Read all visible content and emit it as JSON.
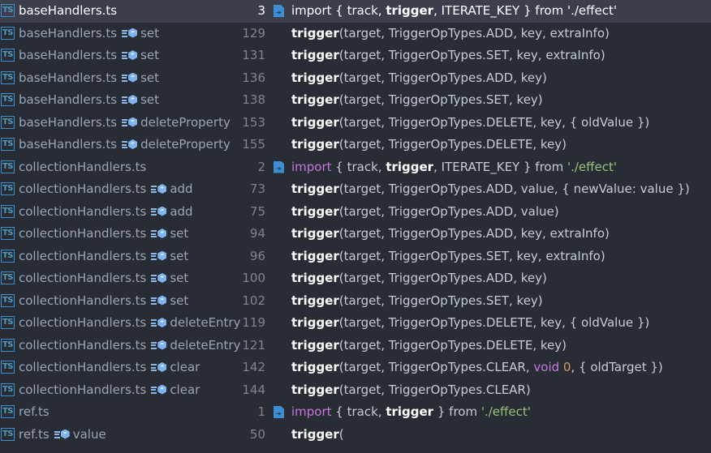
{
  "results": [
    {
      "file": "baseHandlers.ts",
      "symbol": "",
      "line": "3",
      "import": true,
      "selected": true,
      "code": [
        {
          "t": "import",
          "k": "kw"
        },
        {
          "t": " { track, "
        },
        {
          "t": "trigger",
          "k": "match"
        },
        {
          "t": ", ITERATE_KEY } from "
        },
        {
          "t": "'./effect'",
          "k": "str"
        }
      ]
    },
    {
      "file": "baseHandlers.ts",
      "symbol": "set",
      "line": "129",
      "code": [
        {
          "t": "trigger",
          "k": "match"
        },
        {
          "t": "(target, TriggerOpTypes.ADD, key, extraInfo)"
        }
      ]
    },
    {
      "file": "baseHandlers.ts",
      "symbol": "set",
      "line": "131",
      "code": [
        {
          "t": "trigger",
          "k": "match"
        },
        {
          "t": "(target, TriggerOpTypes.SET, key, extraInfo)"
        }
      ]
    },
    {
      "file": "baseHandlers.ts",
      "symbol": "set",
      "line": "136",
      "code": [
        {
          "t": "trigger",
          "k": "match"
        },
        {
          "t": "(target, TriggerOpTypes.ADD, key)"
        }
      ]
    },
    {
      "file": "baseHandlers.ts",
      "symbol": "set",
      "line": "138",
      "code": [
        {
          "t": "trigger",
          "k": "match"
        },
        {
          "t": "(target, TriggerOpTypes.SET, key)"
        }
      ]
    },
    {
      "file": "baseHandlers.ts",
      "symbol": "deleteProperty",
      "line": "153",
      "code": [
        {
          "t": "trigger",
          "k": "match"
        },
        {
          "t": "(target, TriggerOpTypes.DELETE, key, { oldValue })"
        }
      ]
    },
    {
      "file": "baseHandlers.ts",
      "symbol": "deleteProperty",
      "line": "155",
      "code": [
        {
          "t": "trigger",
          "k": "match"
        },
        {
          "t": "(target, TriggerOpTypes.DELETE, key)"
        }
      ]
    },
    {
      "file": "collectionHandlers.ts",
      "symbol": "",
      "line": "2",
      "import": true,
      "code": [
        {
          "t": "import",
          "k": "kw"
        },
        {
          "t": " { track, "
        },
        {
          "t": "trigger",
          "k": "match"
        },
        {
          "t": ", ITERATE_KEY } from "
        },
        {
          "t": "'./effect'",
          "k": "str"
        }
      ]
    },
    {
      "file": "collectionHandlers.ts",
      "symbol": "add",
      "line": "73",
      "code": [
        {
          "t": "trigger",
          "k": "match"
        },
        {
          "t": "(target, TriggerOpTypes.ADD, value, { newValue: value })"
        }
      ]
    },
    {
      "file": "collectionHandlers.ts",
      "symbol": "add",
      "line": "75",
      "code": [
        {
          "t": "trigger",
          "k": "match"
        },
        {
          "t": "(target, TriggerOpTypes.ADD, value)"
        }
      ]
    },
    {
      "file": "collectionHandlers.ts",
      "symbol": "set",
      "line": "94",
      "code": [
        {
          "t": "trigger",
          "k": "match"
        },
        {
          "t": "(target, TriggerOpTypes.ADD, key, extraInfo)"
        }
      ]
    },
    {
      "file": "collectionHandlers.ts",
      "symbol": "set",
      "line": "96",
      "code": [
        {
          "t": "trigger",
          "k": "match"
        },
        {
          "t": "(target, TriggerOpTypes.SET, key, extraInfo)"
        }
      ]
    },
    {
      "file": "collectionHandlers.ts",
      "symbol": "set",
      "line": "100",
      "code": [
        {
          "t": "trigger",
          "k": "match"
        },
        {
          "t": "(target, TriggerOpTypes.ADD, key)"
        }
      ]
    },
    {
      "file": "collectionHandlers.ts",
      "symbol": "set",
      "line": "102",
      "code": [
        {
          "t": "trigger",
          "k": "match"
        },
        {
          "t": "(target, TriggerOpTypes.SET, key)"
        }
      ]
    },
    {
      "file": "collectionHandlers.ts",
      "symbol": "deleteEntry",
      "line": "119",
      "code": [
        {
          "t": "trigger",
          "k": "match"
        },
        {
          "t": "(target, TriggerOpTypes.DELETE, key, { oldValue })"
        }
      ]
    },
    {
      "file": "collectionHandlers.ts",
      "symbol": "deleteEntry",
      "line": "121",
      "code": [
        {
          "t": "trigger",
          "k": "match"
        },
        {
          "t": "(target, TriggerOpTypes.DELETE, key)"
        }
      ]
    },
    {
      "file": "collectionHandlers.ts",
      "symbol": "clear",
      "line": "142",
      "code": [
        {
          "t": "trigger",
          "k": "match"
        },
        {
          "t": "(target, TriggerOpTypes.CLEAR, "
        },
        {
          "t": "void",
          "k": "kw"
        },
        {
          "t": " "
        },
        {
          "t": "0",
          "k": "num"
        },
        {
          "t": ", { oldTarget })"
        }
      ]
    },
    {
      "file": "collectionHandlers.ts",
      "symbol": "clear",
      "line": "144",
      "code": [
        {
          "t": "trigger",
          "k": "match"
        },
        {
          "t": "(target, TriggerOpTypes.CLEAR)"
        }
      ]
    },
    {
      "file": "ref.ts",
      "symbol": "",
      "line": "1",
      "import": true,
      "code": [
        {
          "t": "import",
          "k": "kw"
        },
        {
          "t": " { track, "
        },
        {
          "t": "trigger",
          "k": "match"
        },
        {
          "t": " } from "
        },
        {
          "t": "'./effect'",
          "k": "str"
        }
      ]
    },
    {
      "file": "ref.ts",
      "symbol": "value",
      "line": "50",
      "code": [
        {
          "t": "trigger",
          "k": "match"
        },
        {
          "t": "("
        }
      ]
    }
  ],
  "file_type_badge": "TS",
  "icons": {
    "file_type": "typescript-file-icon",
    "symbol": "method-symbol-icon",
    "import": "import-file-icon"
  },
  "colors": {
    "background": "#282c34",
    "selected_row": "#3a3f4b",
    "keyword": "#c678dd",
    "string": "#98c379",
    "number": "#d19a66",
    "ts_badge": "#519aba"
  }
}
